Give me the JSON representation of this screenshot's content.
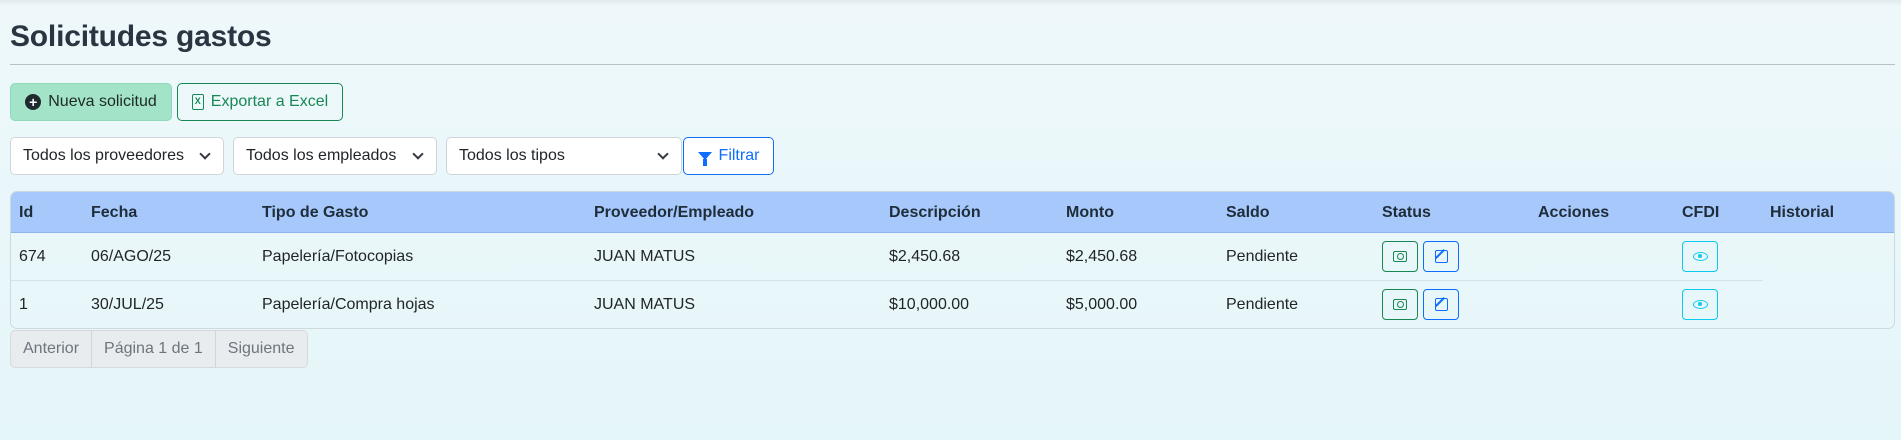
{
  "page": {
    "title": "Solicitudes gastos"
  },
  "toolbar": {
    "new_label": "Nueva solicitud",
    "export_label": "Exportar a Excel",
    "export_icon_glyph": "X"
  },
  "filters": {
    "proveedores": "Todos los proveedores",
    "empleados": "Todos los empleados",
    "tipos": "Todos los tipos",
    "filter_label": "Filtrar"
  },
  "table": {
    "columns": [
      "Id",
      "Fecha",
      "Tipo de Gasto",
      "Proveedor/Empleado",
      "Descripción",
      "Monto",
      "Saldo",
      "Status",
      "Acciones",
      "CFDI",
      "Historial"
    ],
    "rows": [
      {
        "id": "674",
        "fecha": "06/AGO/25",
        "tipo": "Papelería/Fotocopias",
        "proveedor": "JUAN MATUS",
        "descripcion": "$2,450.68",
        "monto": "$2,450.68",
        "saldo": "Pendiente"
      },
      {
        "id": "1",
        "fecha": "30/JUL/25",
        "tipo": "Papelería/Compra hojas",
        "proveedor": "JUAN MATUS",
        "descripcion": "$10,000.00",
        "monto": "$5,000.00",
        "saldo": "Pendiente"
      }
    ]
  },
  "pagination": {
    "prev": "Anterior",
    "info": "Página 1 de 1",
    "next": "Siguiente"
  },
  "colors": {
    "header_bg": "#a6c8fa",
    "success": "#198754",
    "primary": "#0d6efd",
    "info": "#0dcaf0",
    "new_button_bg": "#a3e4c8"
  },
  "icons": {
    "new": "plus-circle-icon",
    "export": "file-excel-icon",
    "filter": "funnel-icon",
    "pay": "money-icon",
    "edit": "edit-icon",
    "view": "eye-icon",
    "dropdown": "chevron-down-icon"
  }
}
